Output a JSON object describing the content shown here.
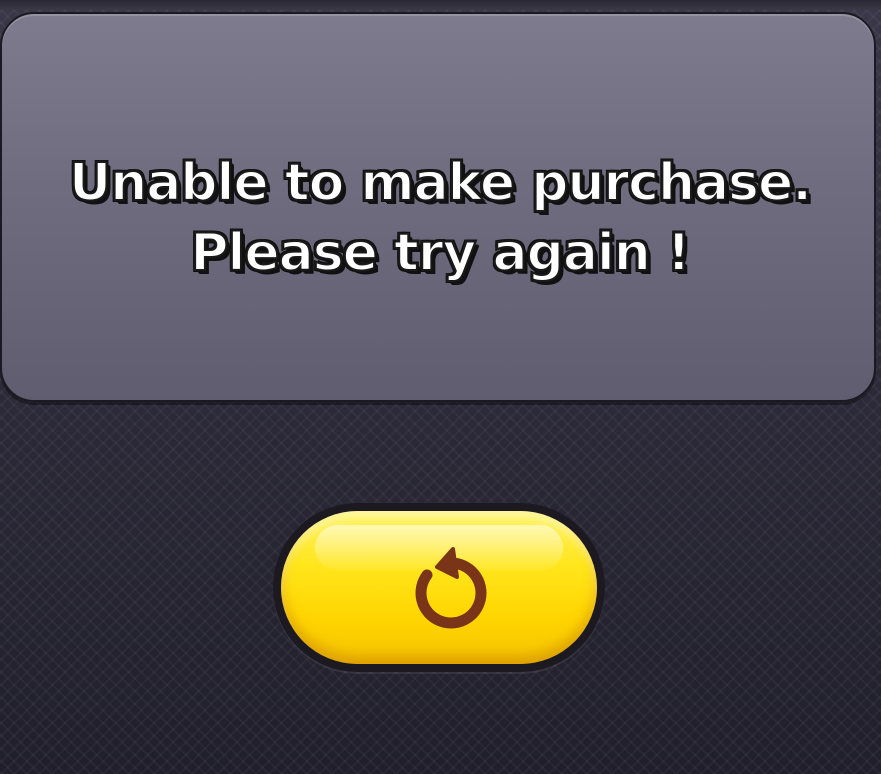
{
  "dialog": {
    "message_line_1": "Unable to make purchase.",
    "message_line_2": "Please try again !"
  },
  "retry_button": {
    "icon": "retry-arrow-icon"
  },
  "colors": {
    "panel": "#75728a",
    "background": "#2b2937",
    "button_yellow": "#ffdd00",
    "icon_brown": "#7a3418",
    "text": "#ffffff",
    "text_outline": "#111111"
  }
}
